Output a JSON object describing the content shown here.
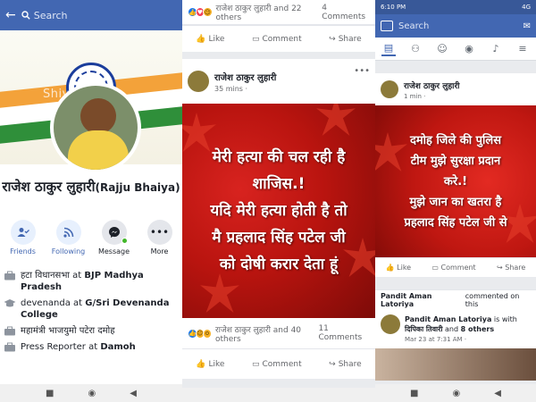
{
  "profile": {
    "search_placeholder": "Search",
    "cover_watermark": "Shiv Rajak",
    "name": "राजेश ठाकुर लुहारी",
    "nickname": "(Rajju Bhaiya)",
    "actions": [
      {
        "label": "Friends",
        "icon": "friends-check-icon"
      },
      {
        "label": "Following",
        "icon": "rss-follow-icon"
      },
      {
        "label": "Message",
        "icon": "messenger-icon"
      },
      {
        "label": "More",
        "icon": "more-dots-icon"
      }
    ],
    "intro": [
      {
        "prefix": "हटा विधानसभा at ",
        "bold": "BJP Madhya Pradesh"
      },
      {
        "prefix": "devenanda at ",
        "bold": "G/Sri Devenanda College"
      },
      {
        "prefix": "महामंत्री भाजयुमो पटेरा दमोह",
        "bold": ""
      },
      {
        "prefix": "Press Reporter at ",
        "bold": "Damoh"
      }
    ]
  },
  "feed": {
    "top_reactions": "राजेश ठाकुर लुहारी and 22 others",
    "top_comments": "4 Comments",
    "actions": {
      "like": "Like",
      "comment": "Comment",
      "share": "Share"
    },
    "post": {
      "author": "राजेश ठाकुर लुहारी",
      "time": "35 mins ·",
      "lines": [
        "मेरी हत्या की चल रही है",
        "शाजिस.!",
        "यदि मेरी हत्या होती है तो",
        "मै प्रहलाद सिंह पटेल जी",
        "को दोषी करार देता हूं"
      ],
      "reactions": "राजेश ठाकुर लुहारी and 40 others",
      "comments": "11 Comments"
    }
  },
  "panel3": {
    "status_time": "6:10 PM",
    "status_right": "4G",
    "search_placeholder": "Search",
    "post": {
      "author": "राजेश ठाकुर लुहारी",
      "time": "1 min ·",
      "lines": [
        "दमोह जिले की पुलिस",
        "टीम मुझे सुरक्षा प्रदान",
        "करे.!",
        "मुझे जान का खतरा है",
        "प्रहलाद सिंह पटेल जी से"
      ]
    },
    "actions": {
      "like": "Like",
      "comment": "Comment",
      "share": "Share"
    },
    "commented": {
      "name": "Pandit Aman Latoriya",
      "text": "commented on this"
    },
    "second_post": {
      "name": "Pandit Aman Latoriya",
      "with_text": "is with",
      "with_name": "दिपिका तिवारी",
      "and_text": "and",
      "others": "8 others",
      "time": "Mar 23 at 7:31 AM ·"
    }
  }
}
